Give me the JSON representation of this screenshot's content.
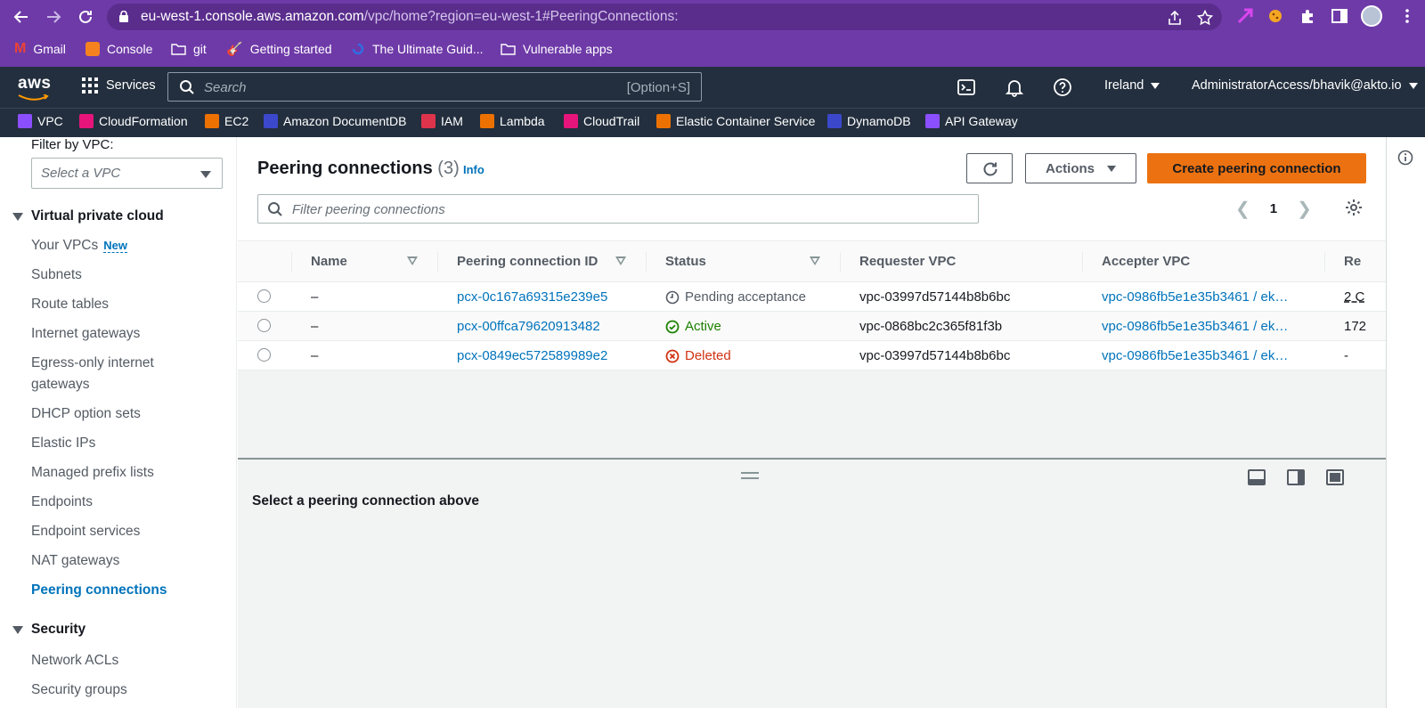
{
  "browser": {
    "url_host": "eu-west-1.console.aws.amazon.com",
    "url_path": "/vpc/home?region=eu-west-1#PeeringConnections:",
    "bookmarks": [
      {
        "label": "Gmail",
        "color": "#ea4335"
      },
      {
        "label": "Console",
        "color": "#f6821f"
      },
      {
        "label": "git",
        "color": "#ffffff"
      },
      {
        "label": "Getting started",
        "color": "#e8553d"
      },
      {
        "label": "The Ultimate Guid...",
        "color": "#2f6ee5"
      },
      {
        "label": "Vulnerable apps",
        "color": "#ffffff"
      }
    ]
  },
  "aws_header": {
    "logo": "aws",
    "services_label": "Services",
    "search_placeholder": "Search",
    "search_shortcut": "[Option+S]",
    "region": "Ireland",
    "account": "AdministratorAccess/bhavik@akto.io",
    "favorites": [
      {
        "label": "VPC",
        "color": "#8c4fff"
      },
      {
        "label": "CloudFormation",
        "color": "#e7157b"
      },
      {
        "label": "EC2",
        "color": "#ed7100"
      },
      {
        "label": "Amazon DocumentDB",
        "color": "#3b48cc"
      },
      {
        "label": "IAM",
        "color": "#dd344c"
      },
      {
        "label": "Lambda",
        "color": "#ed7100"
      },
      {
        "label": "CloudTrail",
        "color": "#e7157b"
      },
      {
        "label": "Elastic Container Service",
        "color": "#ed7100"
      },
      {
        "label": "DynamoDB",
        "color": "#3b48cc"
      },
      {
        "label": "API Gateway",
        "color": "#8c4fff"
      }
    ]
  },
  "sidebar": {
    "filter_label": "Filter by VPC:",
    "vpc_select_placeholder": "Select a VPC",
    "section_vpc": "Virtual private cloud",
    "items": [
      {
        "label": "Your VPCs",
        "badge": "New"
      },
      {
        "label": "Subnets"
      },
      {
        "label": "Route tables"
      },
      {
        "label": "Internet gateways"
      },
      {
        "label": "Egress-only internet"
      },
      {
        "label": "gateways"
      },
      {
        "label": "DHCP option sets"
      },
      {
        "label": "Elastic IPs"
      },
      {
        "label": "Managed prefix lists"
      },
      {
        "label": "Endpoints"
      },
      {
        "label": "Endpoint services"
      },
      {
        "label": "NAT gateways"
      },
      {
        "label": "Peering connections"
      }
    ],
    "section_security": "Security",
    "security_items": [
      {
        "label": "Network ACLs"
      },
      {
        "label": "Security groups"
      }
    ]
  },
  "main": {
    "title": "Peering connections",
    "count": "(3)",
    "info_label": "Info",
    "actions_label": "Actions",
    "create_label": "Create peering connection",
    "filter_placeholder": "Filter peering connections",
    "page_number": "1",
    "columns": [
      "Name",
      "Peering connection ID",
      "Status",
      "Requester VPC",
      "Accepter VPC",
      "Re"
    ],
    "rows": [
      {
        "name": "–",
        "id": "pcx-0c167a69315e239e5",
        "status": "Pending acceptance",
        "status_type": "pending",
        "requester": "vpc-03997d57144b8b6bc",
        "accepter": "vpc-0986fb5e1e35b3461 / ek…",
        "extra": "2 C"
      },
      {
        "name": "–",
        "id": "pcx-00ffca79620913482",
        "status": "Active",
        "status_type": "active",
        "requester": "vpc-0868bc2c365f81f3b",
        "accepter": "vpc-0986fb5e1e35b3461 / ek…",
        "extra": "172"
      },
      {
        "name": "–",
        "id": "pcx-0849ec572589989e2",
        "status": "Deleted",
        "status_type": "deleted",
        "requester": "vpc-03997d57144b8b6bc",
        "accepter": "vpc-0986fb5e1e35b3461 / ek…",
        "extra": "-"
      }
    ],
    "detail_placeholder": "Select a peering connection above"
  }
}
